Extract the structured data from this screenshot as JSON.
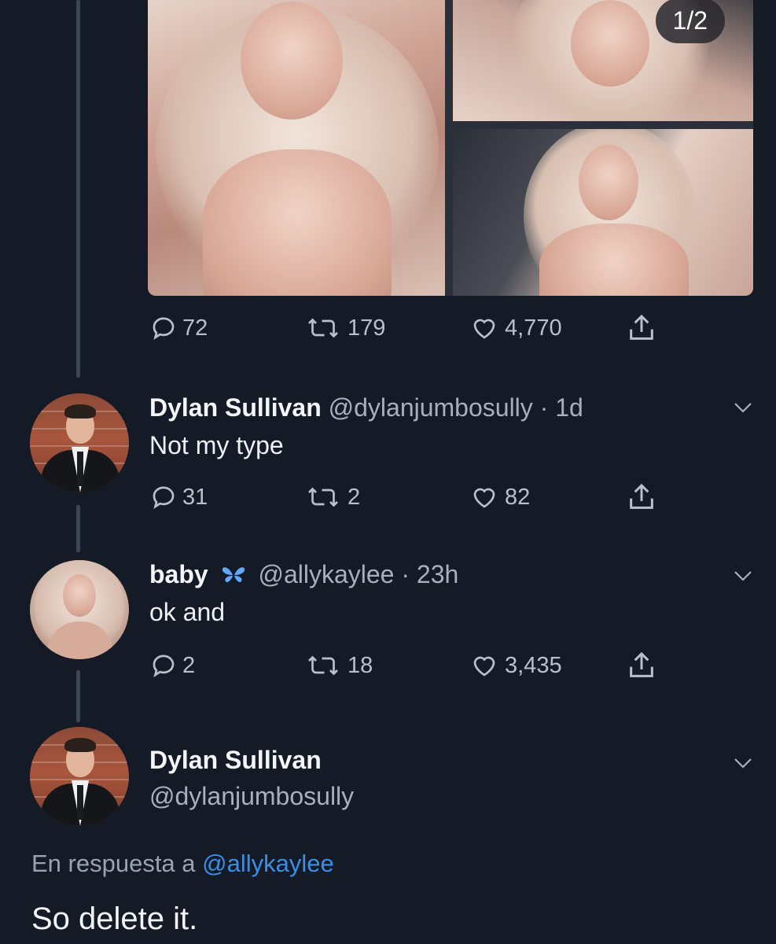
{
  "media": {
    "counter": "1/2"
  },
  "tweets": [
    {
      "actions": {
        "reply": "72",
        "retweet": "179",
        "like": "4,770"
      }
    },
    {
      "name": "Dylan Sullivan",
      "handle": "@dylanjumbosully",
      "time": "· 1d",
      "text": "Not my type",
      "actions": {
        "reply": "31",
        "retweet": "2",
        "like": "82"
      }
    },
    {
      "name": "baby",
      "badge_icon": "butterfly-icon",
      "handle": "@allykaylee",
      "time": "· 23h",
      "text": "ok and",
      "actions": {
        "reply": "2",
        "retweet": "18",
        "like": "3,435"
      }
    },
    {
      "name": "Dylan Sullivan",
      "handle": "@dylanjumbosully",
      "reply_prefix": "En respuesta a",
      "reply_mention": "@allykaylee",
      "text": "So delete it."
    }
  ],
  "colors": {
    "background": "#141a26",
    "accent": "#3a8ee6",
    "muted": "#a8b0bd"
  }
}
